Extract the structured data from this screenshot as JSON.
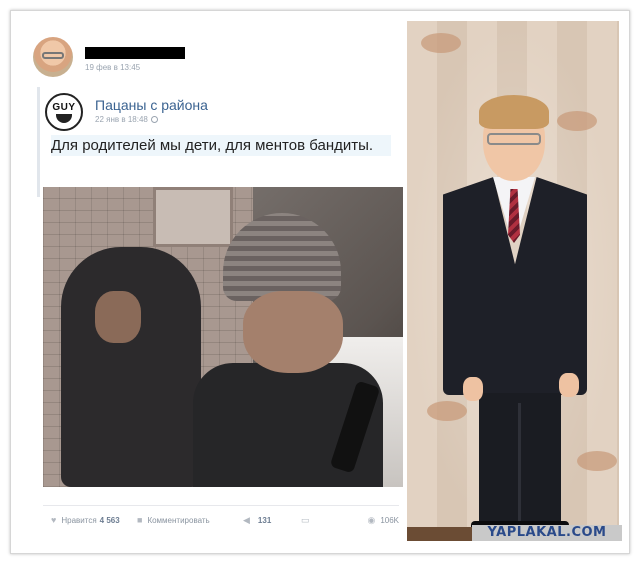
{
  "post": {
    "date": "19 фев в 13:45",
    "repost": {
      "group_name": "Пацаны с района",
      "group_logo_text": "GUY",
      "date": "22 янв в 18:48",
      "text": "Для родителей мы дети, для ментов бандиты."
    },
    "actions": {
      "like_label": "Нравится",
      "like_count": "4 563",
      "comment_label": "Комментировать",
      "share_count": "131",
      "views_count": "106K",
      "icons": {
        "like": "heart-icon",
        "comment": "comment-icon",
        "share": "share-icon",
        "save": "save-icon",
        "views": "eye-icon"
      }
    }
  },
  "watermark": "YAPLAKAL.COM",
  "colors": {
    "link": "#3b6391",
    "meta": "#9aa4b0",
    "watermark_text": "#2a4a8a",
    "watermark_bg": "#c9c9c9"
  }
}
